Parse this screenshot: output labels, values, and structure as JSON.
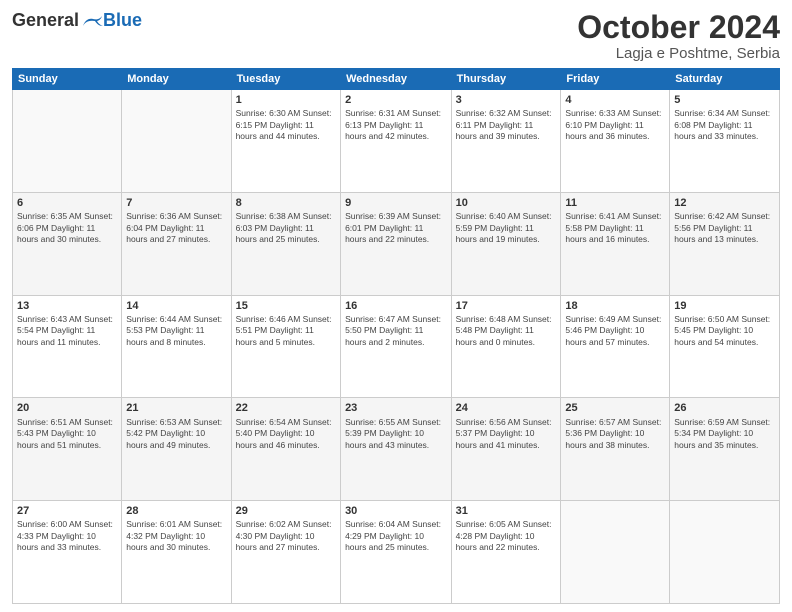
{
  "header": {
    "logo_general": "General",
    "logo_blue": "Blue",
    "month_title": "October 2024",
    "subtitle": "Lagja e Poshtme, Serbia"
  },
  "days_of_week": [
    "Sunday",
    "Monday",
    "Tuesday",
    "Wednesday",
    "Thursday",
    "Friday",
    "Saturday"
  ],
  "weeks": [
    [
      {
        "day": "",
        "info": ""
      },
      {
        "day": "",
        "info": ""
      },
      {
        "day": "1",
        "info": "Sunrise: 6:30 AM\nSunset: 6:15 PM\nDaylight: 11 hours and 44 minutes."
      },
      {
        "day": "2",
        "info": "Sunrise: 6:31 AM\nSunset: 6:13 PM\nDaylight: 11 hours and 42 minutes."
      },
      {
        "day": "3",
        "info": "Sunrise: 6:32 AM\nSunset: 6:11 PM\nDaylight: 11 hours and 39 minutes."
      },
      {
        "day": "4",
        "info": "Sunrise: 6:33 AM\nSunset: 6:10 PM\nDaylight: 11 hours and 36 minutes."
      },
      {
        "day": "5",
        "info": "Sunrise: 6:34 AM\nSunset: 6:08 PM\nDaylight: 11 hours and 33 minutes."
      }
    ],
    [
      {
        "day": "6",
        "info": "Sunrise: 6:35 AM\nSunset: 6:06 PM\nDaylight: 11 hours and 30 minutes."
      },
      {
        "day": "7",
        "info": "Sunrise: 6:36 AM\nSunset: 6:04 PM\nDaylight: 11 hours and 27 minutes."
      },
      {
        "day": "8",
        "info": "Sunrise: 6:38 AM\nSunset: 6:03 PM\nDaylight: 11 hours and 25 minutes."
      },
      {
        "day": "9",
        "info": "Sunrise: 6:39 AM\nSunset: 6:01 PM\nDaylight: 11 hours and 22 minutes."
      },
      {
        "day": "10",
        "info": "Sunrise: 6:40 AM\nSunset: 5:59 PM\nDaylight: 11 hours and 19 minutes."
      },
      {
        "day": "11",
        "info": "Sunrise: 6:41 AM\nSunset: 5:58 PM\nDaylight: 11 hours and 16 minutes."
      },
      {
        "day": "12",
        "info": "Sunrise: 6:42 AM\nSunset: 5:56 PM\nDaylight: 11 hours and 13 minutes."
      }
    ],
    [
      {
        "day": "13",
        "info": "Sunrise: 6:43 AM\nSunset: 5:54 PM\nDaylight: 11 hours and 11 minutes."
      },
      {
        "day": "14",
        "info": "Sunrise: 6:44 AM\nSunset: 5:53 PM\nDaylight: 11 hours and 8 minutes."
      },
      {
        "day": "15",
        "info": "Sunrise: 6:46 AM\nSunset: 5:51 PM\nDaylight: 11 hours and 5 minutes."
      },
      {
        "day": "16",
        "info": "Sunrise: 6:47 AM\nSunset: 5:50 PM\nDaylight: 11 hours and 2 minutes."
      },
      {
        "day": "17",
        "info": "Sunrise: 6:48 AM\nSunset: 5:48 PM\nDaylight: 11 hours and 0 minutes."
      },
      {
        "day": "18",
        "info": "Sunrise: 6:49 AM\nSunset: 5:46 PM\nDaylight: 10 hours and 57 minutes."
      },
      {
        "day": "19",
        "info": "Sunrise: 6:50 AM\nSunset: 5:45 PM\nDaylight: 10 hours and 54 minutes."
      }
    ],
    [
      {
        "day": "20",
        "info": "Sunrise: 6:51 AM\nSunset: 5:43 PM\nDaylight: 10 hours and 51 minutes."
      },
      {
        "day": "21",
        "info": "Sunrise: 6:53 AM\nSunset: 5:42 PM\nDaylight: 10 hours and 49 minutes."
      },
      {
        "day": "22",
        "info": "Sunrise: 6:54 AM\nSunset: 5:40 PM\nDaylight: 10 hours and 46 minutes."
      },
      {
        "day": "23",
        "info": "Sunrise: 6:55 AM\nSunset: 5:39 PM\nDaylight: 10 hours and 43 minutes."
      },
      {
        "day": "24",
        "info": "Sunrise: 6:56 AM\nSunset: 5:37 PM\nDaylight: 10 hours and 41 minutes."
      },
      {
        "day": "25",
        "info": "Sunrise: 6:57 AM\nSunset: 5:36 PM\nDaylight: 10 hours and 38 minutes."
      },
      {
        "day": "26",
        "info": "Sunrise: 6:59 AM\nSunset: 5:34 PM\nDaylight: 10 hours and 35 minutes."
      }
    ],
    [
      {
        "day": "27",
        "info": "Sunrise: 6:00 AM\nSunset: 4:33 PM\nDaylight: 10 hours and 33 minutes."
      },
      {
        "day": "28",
        "info": "Sunrise: 6:01 AM\nSunset: 4:32 PM\nDaylight: 10 hours and 30 minutes."
      },
      {
        "day": "29",
        "info": "Sunrise: 6:02 AM\nSunset: 4:30 PM\nDaylight: 10 hours and 27 minutes."
      },
      {
        "day": "30",
        "info": "Sunrise: 6:04 AM\nSunset: 4:29 PM\nDaylight: 10 hours and 25 minutes."
      },
      {
        "day": "31",
        "info": "Sunrise: 6:05 AM\nSunset: 4:28 PM\nDaylight: 10 hours and 22 minutes."
      },
      {
        "day": "",
        "info": ""
      },
      {
        "day": "",
        "info": ""
      }
    ]
  ]
}
